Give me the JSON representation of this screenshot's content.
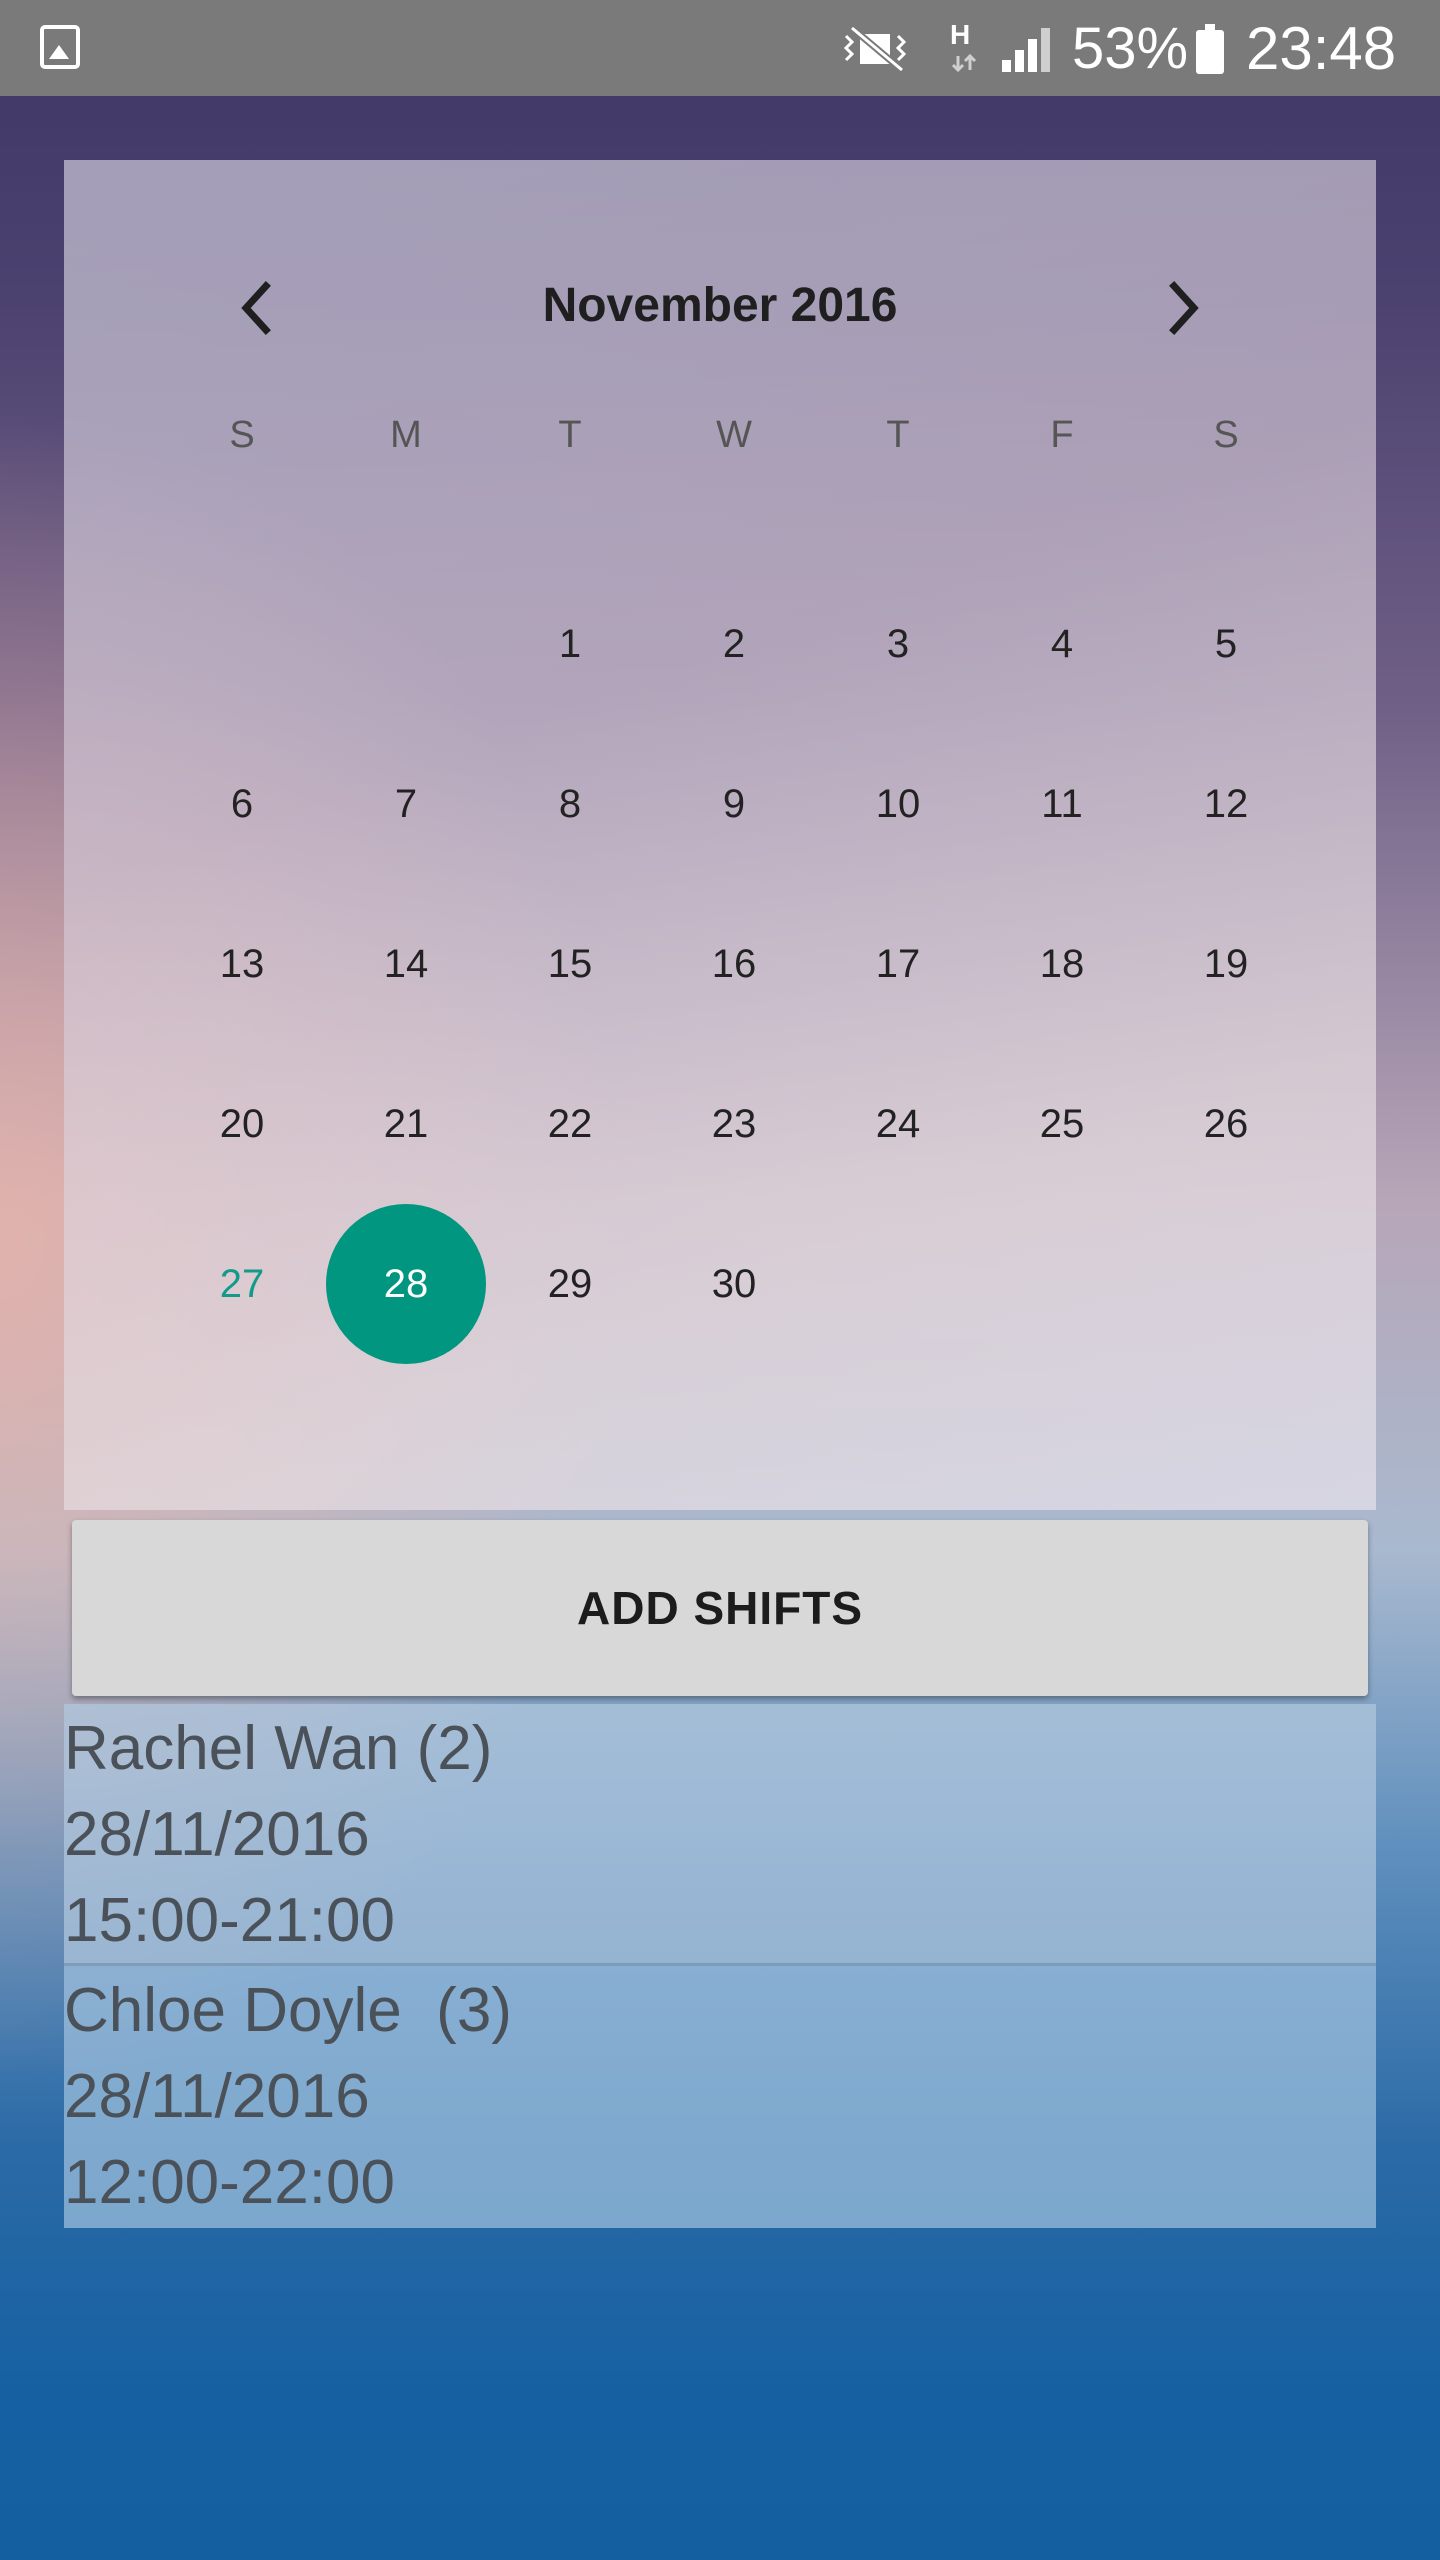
{
  "status_bar": {
    "icons": [
      "gallery-icon",
      "mute-vibrate-icon",
      "hspa-data-icon",
      "signal-icon",
      "battery-icon"
    ],
    "data_type": "H",
    "battery": "53%",
    "time": "23:48"
  },
  "calendar": {
    "month_label": "November 2016",
    "prev_icon": "chevron-left-icon",
    "next_icon": "chevron-right-icon",
    "weekdays": [
      "S",
      "M",
      "T",
      "W",
      "T",
      "F",
      "S"
    ],
    "weeks": [
      [
        "",
        "",
        "1",
        "2",
        "3",
        "4",
        "5"
      ],
      [
        "6",
        "7",
        "8",
        "9",
        "10",
        "11",
        "12"
      ],
      [
        "13",
        "14",
        "15",
        "16",
        "17",
        "18",
        "19"
      ],
      [
        "20",
        "21",
        "22",
        "23",
        "24",
        "25",
        "26"
      ],
      [
        "27",
        "28",
        "29",
        "30",
        "",
        "",
        ""
      ]
    ],
    "today": "27",
    "selected": "28",
    "accent_color": "#00967f"
  },
  "add_button": {
    "label": "ADD SHIFTS"
  },
  "shifts": [
    {
      "name": "Rachel Wan (2)",
      "date": "28/11/2016",
      "time": "15:00-21:00"
    },
    {
      "name": "Chloe Doyle  (3)",
      "date": "28/11/2016",
      "time": "12:00-22:00"
    }
  ]
}
